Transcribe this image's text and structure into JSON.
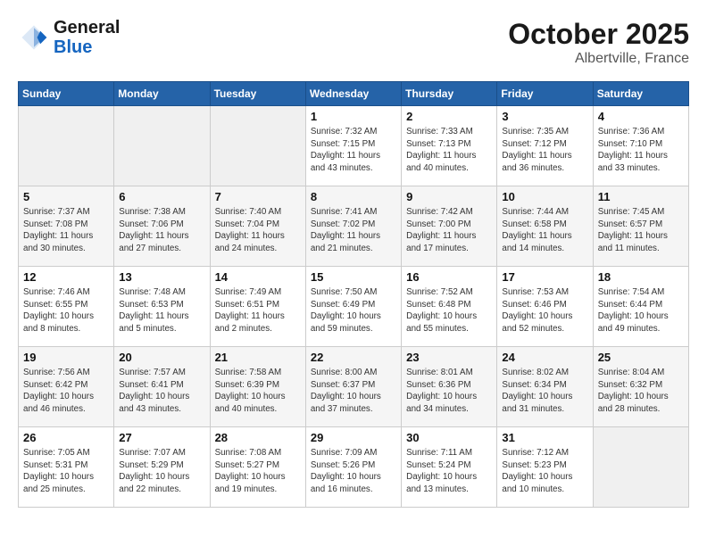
{
  "header": {
    "logo": {
      "line1": "General",
      "line2": "Blue"
    },
    "title": "October 2025",
    "location": "Albertville, France"
  },
  "weekdays": [
    "Sunday",
    "Monday",
    "Tuesday",
    "Wednesday",
    "Thursday",
    "Friday",
    "Saturday"
  ],
  "weeks": [
    [
      {
        "day": "",
        "sunrise": "",
        "sunset": "",
        "daylight": "",
        "empty": true
      },
      {
        "day": "",
        "sunrise": "",
        "sunset": "",
        "daylight": "",
        "empty": true
      },
      {
        "day": "",
        "sunrise": "",
        "sunset": "",
        "daylight": "",
        "empty": true
      },
      {
        "day": "1",
        "sunrise": "7:32 AM",
        "sunset": "7:15 PM",
        "daylight": "11 hours and 43 minutes."
      },
      {
        "day": "2",
        "sunrise": "7:33 AM",
        "sunset": "7:13 PM",
        "daylight": "11 hours and 40 minutes."
      },
      {
        "day": "3",
        "sunrise": "7:35 AM",
        "sunset": "7:12 PM",
        "daylight": "11 hours and 36 minutes."
      },
      {
        "day": "4",
        "sunrise": "7:36 AM",
        "sunset": "7:10 PM",
        "daylight": "11 hours and 33 minutes."
      }
    ],
    [
      {
        "day": "5",
        "sunrise": "7:37 AM",
        "sunset": "7:08 PM",
        "daylight": "11 hours and 30 minutes."
      },
      {
        "day": "6",
        "sunrise": "7:38 AM",
        "sunset": "7:06 PM",
        "daylight": "11 hours and 27 minutes."
      },
      {
        "day": "7",
        "sunrise": "7:40 AM",
        "sunset": "7:04 PM",
        "daylight": "11 hours and 24 minutes."
      },
      {
        "day": "8",
        "sunrise": "7:41 AM",
        "sunset": "7:02 PM",
        "daylight": "11 hours and 21 minutes."
      },
      {
        "day": "9",
        "sunrise": "7:42 AM",
        "sunset": "7:00 PM",
        "daylight": "11 hours and 17 minutes."
      },
      {
        "day": "10",
        "sunrise": "7:44 AM",
        "sunset": "6:58 PM",
        "daylight": "11 hours and 14 minutes."
      },
      {
        "day": "11",
        "sunrise": "7:45 AM",
        "sunset": "6:57 PM",
        "daylight": "11 hours and 11 minutes."
      }
    ],
    [
      {
        "day": "12",
        "sunrise": "7:46 AM",
        "sunset": "6:55 PM",
        "daylight": "10 hours and 8 minutes."
      },
      {
        "day": "13",
        "sunrise": "7:48 AM",
        "sunset": "6:53 PM",
        "daylight": "11 hours and 5 minutes."
      },
      {
        "day": "14",
        "sunrise": "7:49 AM",
        "sunset": "6:51 PM",
        "daylight": "11 hours and 2 minutes."
      },
      {
        "day": "15",
        "sunrise": "7:50 AM",
        "sunset": "6:49 PM",
        "daylight": "10 hours and 59 minutes."
      },
      {
        "day": "16",
        "sunrise": "7:52 AM",
        "sunset": "6:48 PM",
        "daylight": "10 hours and 55 minutes."
      },
      {
        "day": "17",
        "sunrise": "7:53 AM",
        "sunset": "6:46 PM",
        "daylight": "10 hours and 52 minutes."
      },
      {
        "day": "18",
        "sunrise": "7:54 AM",
        "sunset": "6:44 PM",
        "daylight": "10 hours and 49 minutes."
      }
    ],
    [
      {
        "day": "19",
        "sunrise": "7:56 AM",
        "sunset": "6:42 PM",
        "daylight": "10 hours and 46 minutes."
      },
      {
        "day": "20",
        "sunrise": "7:57 AM",
        "sunset": "6:41 PM",
        "daylight": "10 hours and 43 minutes."
      },
      {
        "day": "21",
        "sunrise": "7:58 AM",
        "sunset": "6:39 PM",
        "daylight": "10 hours and 40 minutes."
      },
      {
        "day": "22",
        "sunrise": "8:00 AM",
        "sunset": "6:37 PM",
        "daylight": "10 hours and 37 minutes."
      },
      {
        "day": "23",
        "sunrise": "8:01 AM",
        "sunset": "6:36 PM",
        "daylight": "10 hours and 34 minutes."
      },
      {
        "day": "24",
        "sunrise": "8:02 AM",
        "sunset": "6:34 PM",
        "daylight": "10 hours and 31 minutes."
      },
      {
        "day": "25",
        "sunrise": "8:04 AM",
        "sunset": "6:32 PM",
        "daylight": "10 hours and 28 minutes."
      }
    ],
    [
      {
        "day": "26",
        "sunrise": "7:05 AM",
        "sunset": "5:31 PM",
        "daylight": "10 hours and 25 minutes."
      },
      {
        "day": "27",
        "sunrise": "7:07 AM",
        "sunset": "5:29 PM",
        "daylight": "10 hours and 22 minutes."
      },
      {
        "day": "28",
        "sunrise": "7:08 AM",
        "sunset": "5:27 PM",
        "daylight": "10 hours and 19 minutes."
      },
      {
        "day": "29",
        "sunrise": "7:09 AM",
        "sunset": "5:26 PM",
        "daylight": "10 hours and 16 minutes."
      },
      {
        "day": "30",
        "sunrise": "7:11 AM",
        "sunset": "5:24 PM",
        "daylight": "10 hours and 13 minutes."
      },
      {
        "day": "31",
        "sunrise": "7:12 AM",
        "sunset": "5:23 PM",
        "daylight": "10 hours and 10 minutes."
      },
      {
        "day": "",
        "sunrise": "",
        "sunset": "",
        "daylight": "",
        "empty": true
      }
    ]
  ]
}
